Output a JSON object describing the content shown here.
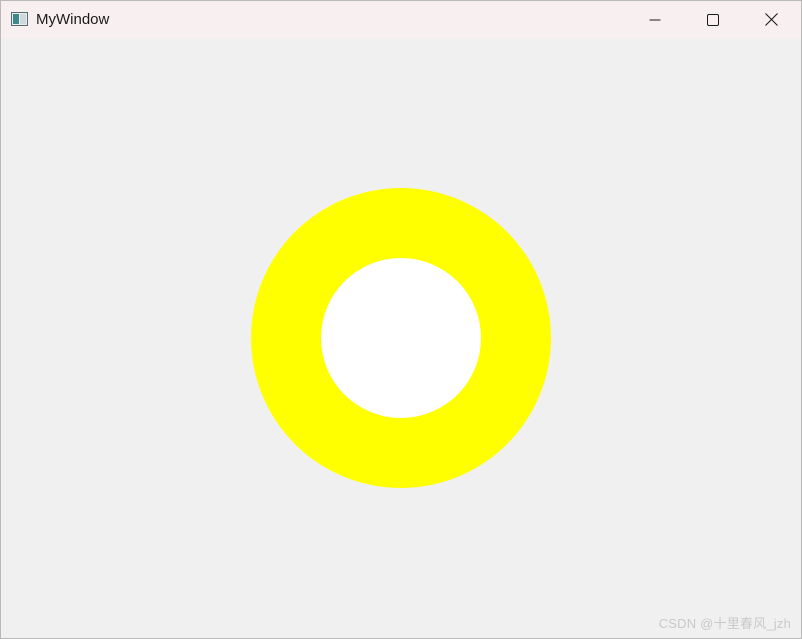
{
  "window": {
    "title": "MyWindow",
    "icon": "app-window-icon",
    "controls": {
      "minimize_icon": "minimize-icon",
      "maximize_icon": "maximize-icon",
      "close_icon": "close-icon"
    }
  },
  "canvas": {
    "background_color": "#f0f0f0",
    "ring": {
      "outer_color": "#ffff00",
      "inner_color": "#ffffff"
    }
  },
  "watermark": {
    "text": "CSDN @十里春风_jzh"
  },
  "colors": {
    "titlebar": "#f8eff1",
    "window_border": "#b9b9b9"
  }
}
